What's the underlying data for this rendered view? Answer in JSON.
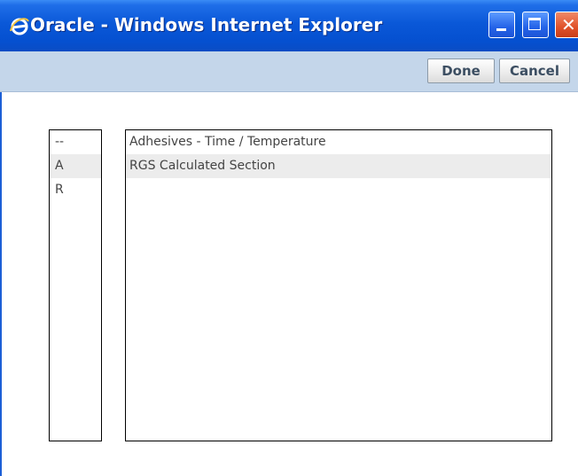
{
  "window": {
    "title": "Oracle - Windows Internet Explorer",
    "icon": "internet-explorer-icon",
    "controls": {
      "minimize": "minimize-icon",
      "maximize": "maximize-icon",
      "close_symbol": "✕"
    }
  },
  "toolbar": {
    "done_label": "Done",
    "cancel_label": "Cancel"
  },
  "index_list": {
    "items": [
      "--",
      "A",
      "R"
    ]
  },
  "section_list": {
    "items": [
      "Adhesives - Time / Temperature",
      "RGS Calculated Section"
    ]
  },
  "colors": {
    "titlebar": "#0550d0",
    "toolbar": "#c4d6ea",
    "alt_row": "#ececec"
  }
}
